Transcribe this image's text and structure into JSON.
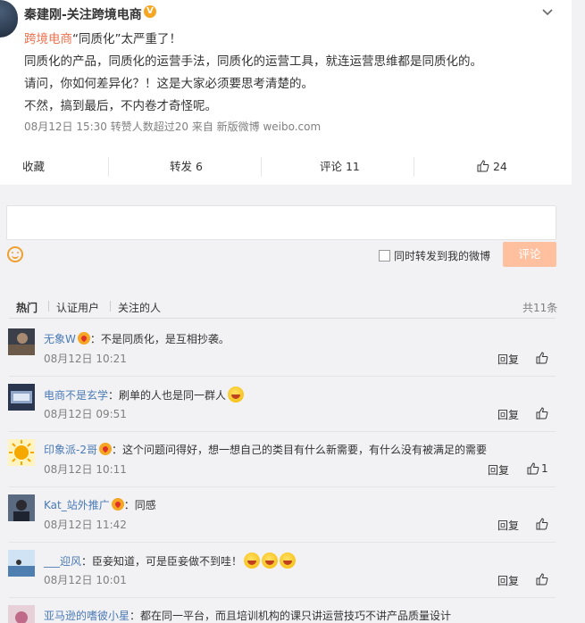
{
  "post": {
    "author": "秦建刚-关注跨境电商",
    "hashtag": "跨境电商",
    "line1_rest": "“同质化”太严重了！",
    "line2": "同质化的产品，同质化的运营手法，同质化的运营工具，就连运营思维都是同质化的。",
    "line3": "请问，你如何差异化？！这是大家必须要思考清楚的。",
    "line4": "不然，搞到最后，不内卷才奇怪呢。",
    "meta": "08月12日 15:30 转赞人数超过20  来自 新版微博 weibo.com"
  },
  "actions": {
    "collect": "收藏",
    "repost": "转发 6",
    "comment": "评论 11",
    "like": "24"
  },
  "composer": {
    "repost_label": "同时转发到我的微博",
    "submit": "评论"
  },
  "comments_panel": {
    "tabs": [
      "热门",
      "认证用户",
      "关注的人"
    ],
    "total": "共11条",
    "reply_label": "回复",
    "items": [
      {
        "user": "无象W",
        "text": "：不是同质化，是互相抄袭。",
        "time": "08月12日 10:21",
        "likes": ""
      },
      {
        "user": "电商不是玄学",
        "text": "：刷单的人也是同一群人",
        "time": "08月12日 09:51",
        "likes": ""
      },
      {
        "user": "印象派-2哥",
        "text": "：这个问题问得好，想一想自己的类目有什么新需要，有什么没有被满足的需要",
        "time": "08月12日 10:11",
        "likes": "1"
      },
      {
        "user": "Kat_站外推广",
        "text": "：同感",
        "time": "08月12日 11:42",
        "likes": ""
      },
      {
        "user": "___迎风",
        "text": "：臣妾知道，可是臣妾做不到哇！",
        "time": "08月12日 10:01",
        "likes": ""
      },
      {
        "user": "亚马逊的嗜彼小星",
        "text": "：都在同一平台，而且培训机构的课只讲运营技巧不讲产品质量设计",
        "time": "",
        "likes": ""
      }
    ]
  },
  "colors": {
    "accent": "#eb7350",
    "submit_bg": "#ffc09f",
    "page_bg": "#f2f2f5"
  }
}
